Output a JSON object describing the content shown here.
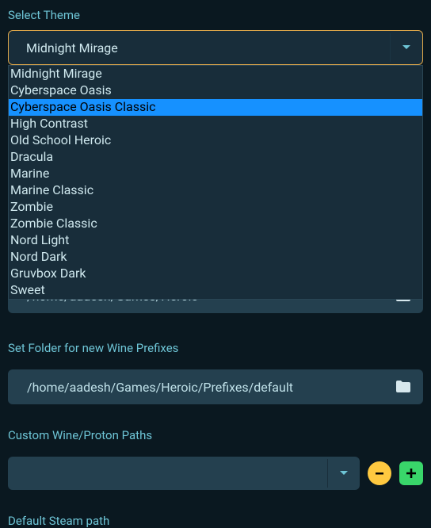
{
  "colors": {
    "background": "#0a1820",
    "panel": "#24404f",
    "panelDark": "#182d3a",
    "accent": "#6ec5d6",
    "focusBorder": "#e0a84a",
    "highlight": "#1691ff",
    "textLight": "#cfe8ee",
    "minus": "#ffc940",
    "plus": "#39d66a"
  },
  "theme": {
    "label": "Select Theme",
    "selected": "Midnight Mirage",
    "options": [
      "Midnight Mirage",
      "Cyberspace Oasis",
      "Cyberspace Oasis Classic",
      "High Contrast",
      "Old School Heroic",
      "Dracula",
      "Marine",
      "Marine Classic",
      "Zombie",
      "Zombie Classic",
      "Nord Light",
      "Nord Dark",
      "Gruvbox Dark",
      "Sweet"
    ],
    "highlighted_index": 2
  },
  "install_path": {
    "value": "/home/aadesh/Games/Heroic"
  },
  "wine_prefixes": {
    "label": "Set Folder for new Wine Prefixes",
    "value": "/home/aadesh/Games/Heroic/Prefixes/default"
  },
  "custom_paths": {
    "label": "Custom Wine/Proton Paths",
    "selected": ""
  },
  "steam_path": {
    "label": "Default Steam path"
  }
}
